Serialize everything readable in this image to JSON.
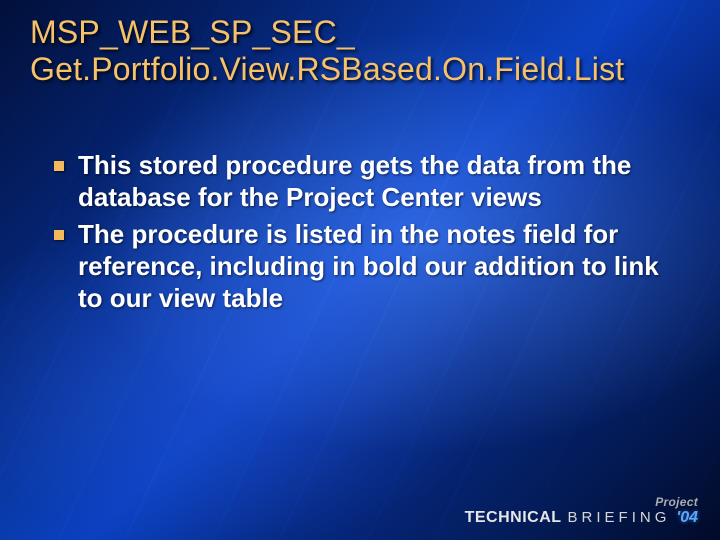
{
  "title": {
    "line1": "MSP_WEB_SP_SEC_",
    "line2": "Get.Portfolio.View.RSBased.On.Field.List"
  },
  "bullets": [
    "This stored procedure gets the data from the database for the Project Center views",
    "The procedure is listed in the notes field for reference, including in bold our addition to link to our view table"
  ],
  "footer": {
    "project": "Project",
    "tech_word": "TECHNICAL",
    "briefing_word": "BRIEFING",
    "year": "'04"
  },
  "colors": {
    "title": "#f6c169",
    "bullet_marker": "#f3b95a",
    "body_text": "#ffffff",
    "year_accent": "#5aa7ff"
  }
}
